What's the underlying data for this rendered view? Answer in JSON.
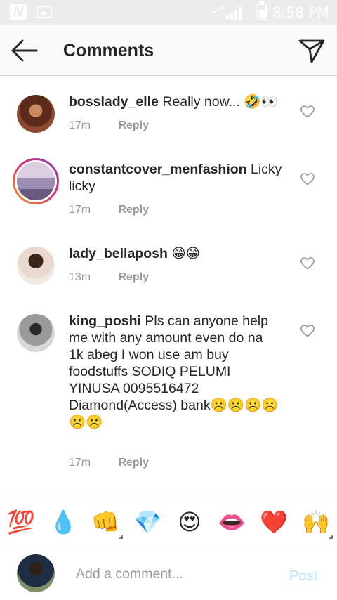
{
  "status_bar": {
    "time": "8:58 PM",
    "left_icons": [
      "n-icon",
      "image-icon"
    ],
    "right_icons": [
      "wifi-icon",
      "signal-icon",
      "battery-icon"
    ]
  },
  "header": {
    "title": "Comments",
    "back_icon": "back-arrow-icon",
    "share_icon": "send-icon"
  },
  "comments": [
    {
      "username": "bosslady_elle",
      "text": "Really now... 🤣👀",
      "time": "17m",
      "reply_label": "Reply",
      "story_ring": false
    },
    {
      "username": "constantcover_menfashion",
      "text": "Licky licky",
      "time": "17m",
      "reply_label": "Reply",
      "story_ring": true
    },
    {
      "username": "lady_bellaposh",
      "text": "😁😁",
      "time": "13m",
      "reply_label": "Reply",
      "story_ring": false
    },
    {
      "username": "king_poshi",
      "text": "Pls can anyone help me with any amount even do na 1k abeg I won use am buy foodstuffs  SODIQ PELUMI YINUSA 0095516472 Diamond(Access) bank☹️☹️☹️☹️☹️☹️",
      "time": "17m",
      "reply_label": "Reply",
      "story_ring": false
    }
  ],
  "emoji_bar": [
    "💯",
    "💧",
    "👊",
    "💎",
    "😍",
    "👄",
    "❤️",
    "🙌"
  ],
  "input": {
    "placeholder": "Add a comment...",
    "value": "",
    "post_label": "Post"
  },
  "colors": {
    "username": "#262626",
    "meta": "#999999",
    "post_disabled": "#b2dffc",
    "header_bg": "#fafafa",
    "status_bar_bg": "#ececec"
  }
}
